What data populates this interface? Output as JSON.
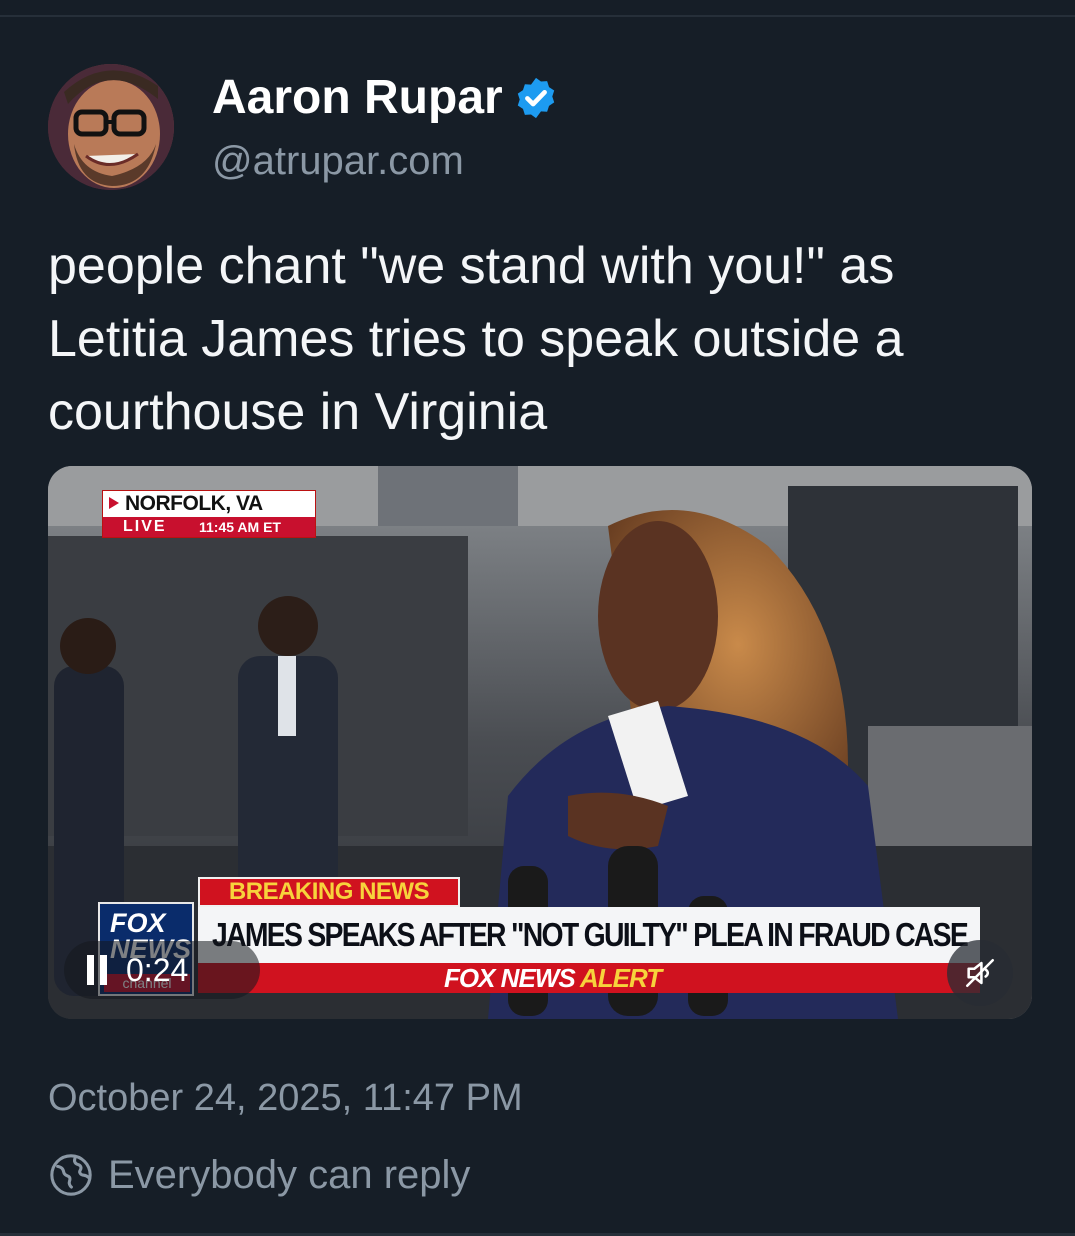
{
  "post": {
    "author_name": "Aaron Rupar",
    "handle": "@atrupar.com",
    "verified": true,
    "text": "people chant \"we stand with you!\" as Letitia James tries to speak outside a courthouse in Virginia",
    "timestamp": "October 24, 2025, 11:47 PM",
    "reply_setting": "Everybody can reply"
  },
  "video": {
    "current_time": "0:24",
    "playing": true,
    "muted": true,
    "overlay": {
      "location": "NORFOLK, VA",
      "live_label": "LIVE",
      "live_time": "11:45 AM ET",
      "breaking_label": "BREAKING NEWS",
      "headline": "JAMES SPEAKS AFTER \"NOT GUILTY\" PLEA IN FRAUD CASE",
      "alert_brand": "FOX NEWS",
      "alert_word": "ALERT",
      "logo_text": "FOX NEWS",
      "logo_sub": "channel"
    }
  },
  "icons": {
    "verified": "verified-badge-icon",
    "pause": "pause-icon",
    "mute": "speaker-muted-icon",
    "reply": "globe-reply-icon"
  },
  "colors": {
    "background": "#161e27",
    "text_primary": "#f4f6f8",
    "text_secondary": "#8b98a5",
    "verified": "#1d9bf0",
    "fox_red": "#d0121f",
    "fox_yellow": "#f7d33c"
  }
}
